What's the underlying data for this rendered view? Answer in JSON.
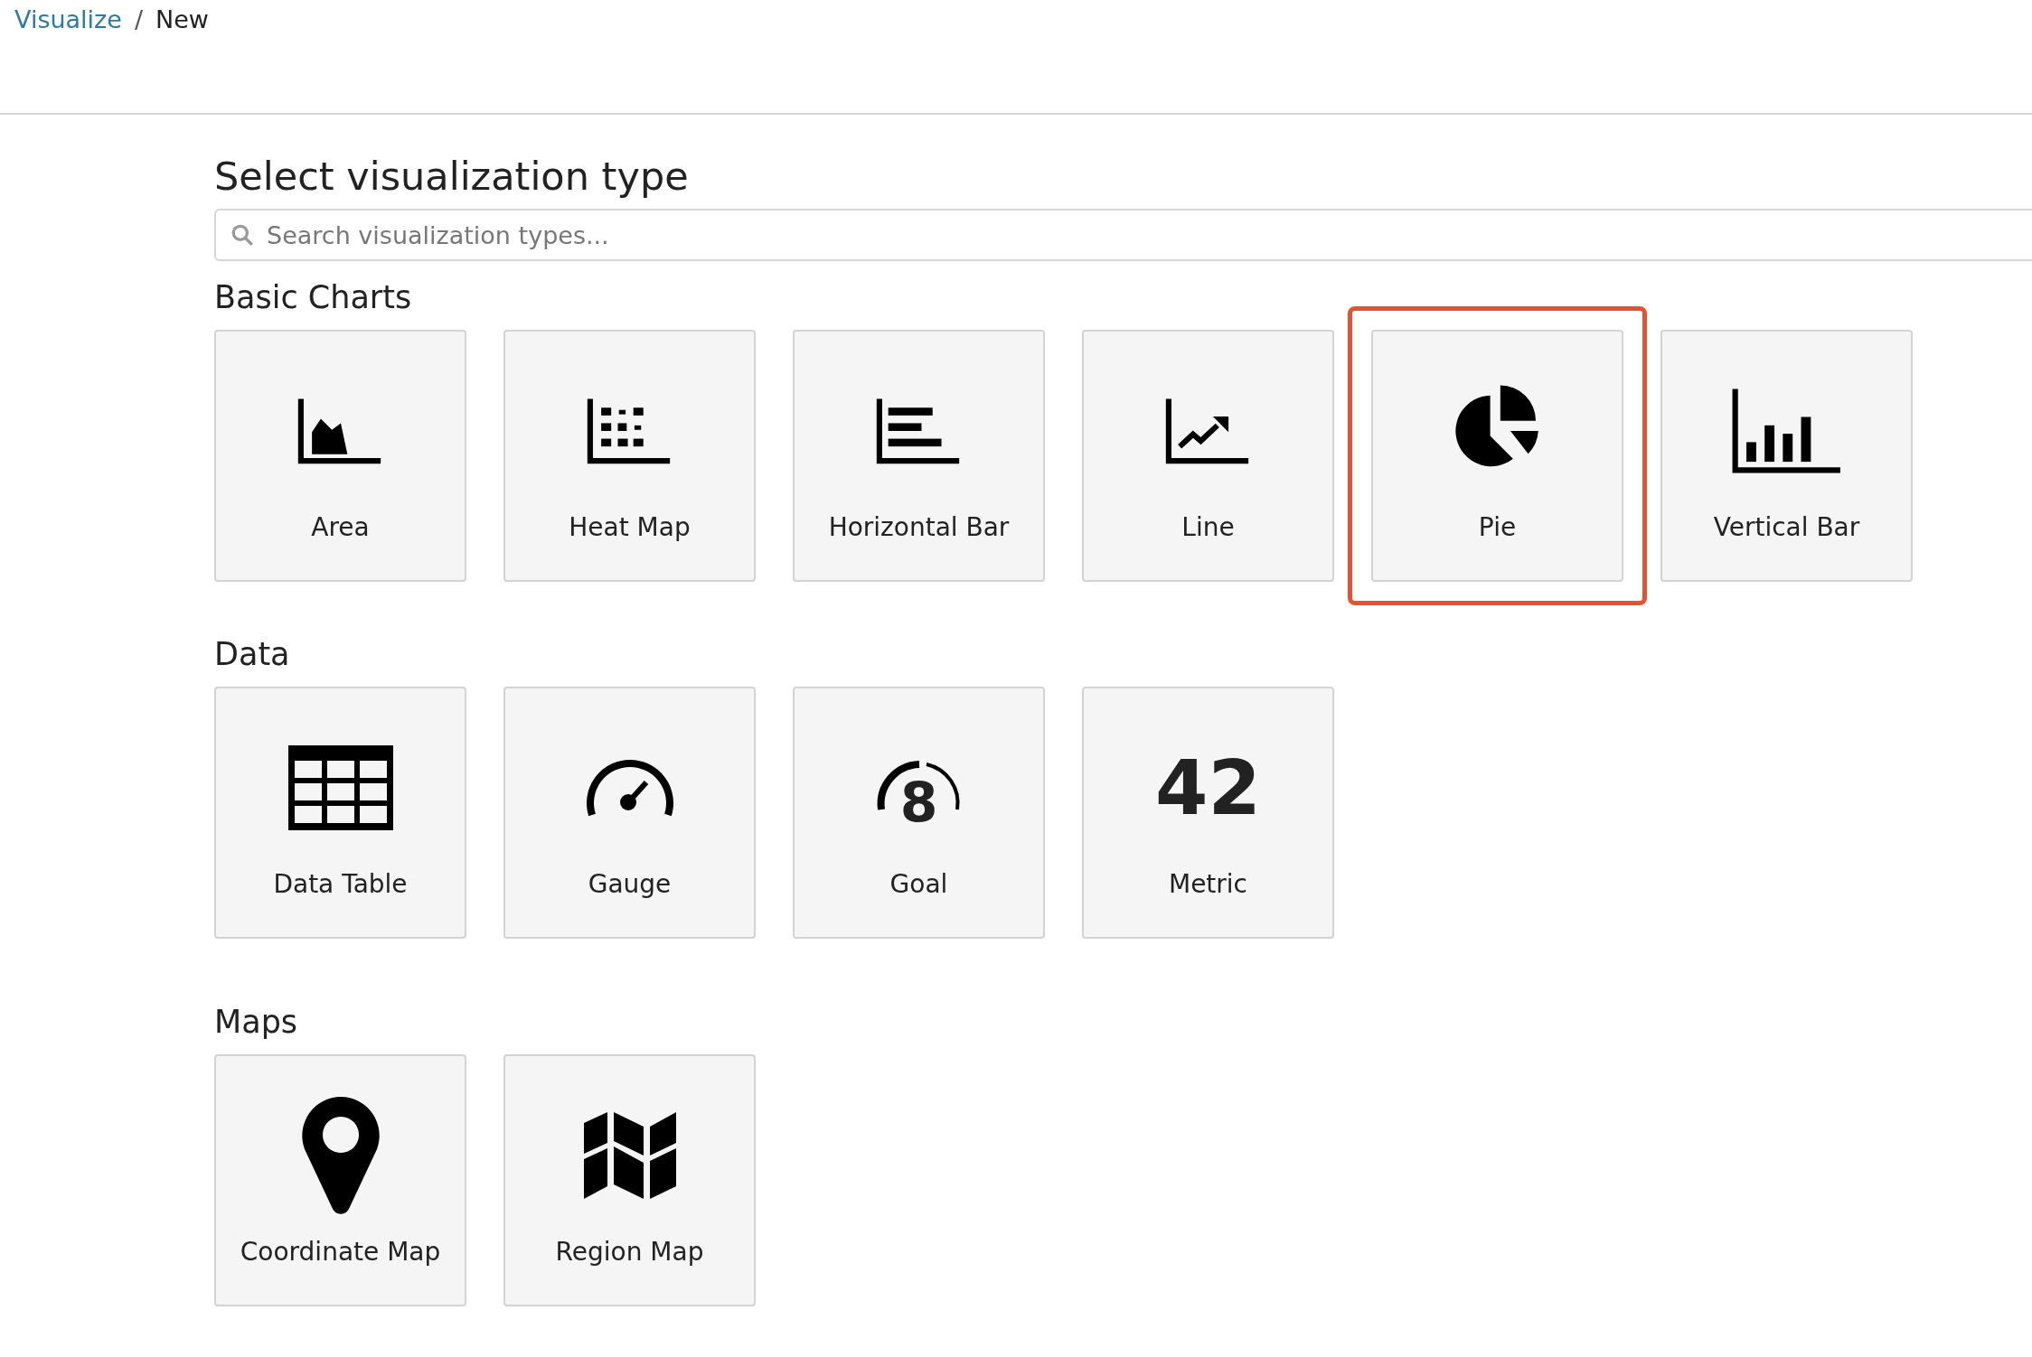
{
  "breadcrumbs": [
    {
      "label": "Visualize",
      "kind": "link"
    },
    {
      "label": "/",
      "kind": "separator"
    },
    {
      "label": "New",
      "kind": "current"
    }
  ],
  "title": "Select visualization type",
  "search": {
    "placeholder": "Search visualization types..."
  },
  "sections": [
    {
      "heading": "Basic Charts",
      "items": [
        {
          "label": "Area",
          "kind": "area",
          "selected": false
        },
        {
          "label": "Heat Map",
          "kind": "heatmap",
          "selected": false
        },
        {
          "label": "Horizontal Bar",
          "kind": "hbar",
          "selected": false
        },
        {
          "label": "Line",
          "kind": "line",
          "selected": false
        },
        {
          "label": "Pie",
          "kind": "pie",
          "selected": true
        },
        {
          "label": "Vertical Bar",
          "kind": "vbar",
          "selected": false
        }
      ]
    },
    {
      "heading": "Data",
      "items": [
        {
          "label": "Data Table",
          "kind": "table",
          "selected": false
        },
        {
          "label": "Gauge",
          "kind": "gauge",
          "selected": false
        },
        {
          "label": "Goal",
          "kind": "goal",
          "icon_text": "8",
          "selected": false
        },
        {
          "label": "Metric",
          "kind": "metric",
          "icon_text": "42",
          "selected": false
        }
      ]
    },
    {
      "heading": "Maps",
      "items": [
        {
          "label": "Coordinate Map",
          "kind": "pin",
          "selected": false
        },
        {
          "label": "Region Map",
          "kind": "map",
          "selected": false
        }
      ]
    }
  ]
}
